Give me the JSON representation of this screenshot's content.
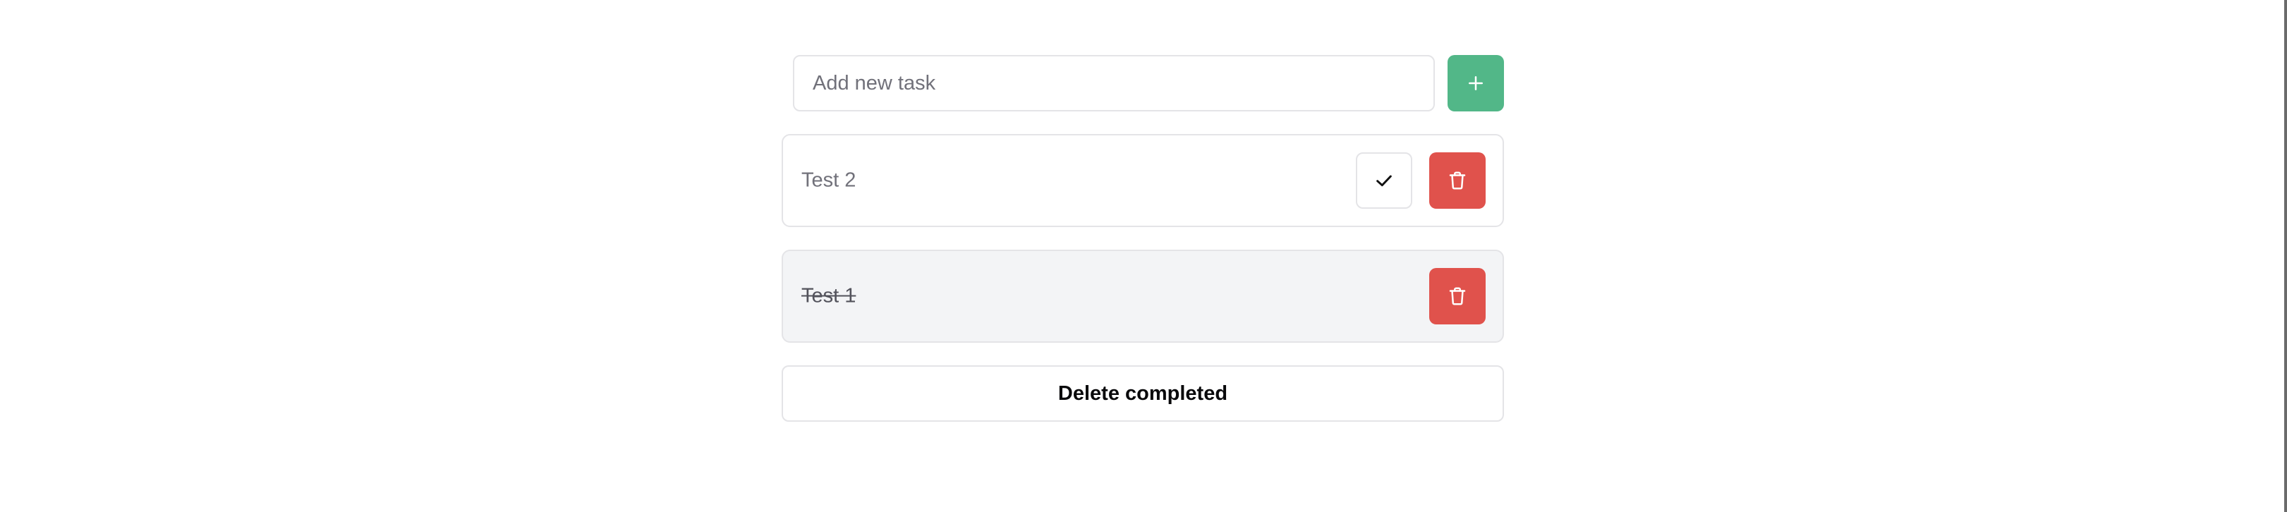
{
  "new_task": {
    "placeholder": "Add new task",
    "value": "",
    "add_icon": "plus-icon"
  },
  "tasks": [
    {
      "label": "Test 2",
      "completed": false,
      "complete_icon": "check-icon",
      "delete_icon": "trash-icon"
    },
    {
      "label": "Test 1",
      "completed": true,
      "delete_icon": "trash-icon"
    }
  ],
  "footer": {
    "delete_completed_label": "Delete completed"
  },
  "colors": {
    "add_button": "#52b788",
    "delete_button": "#e0524c",
    "completed_background": "#f3f4f6",
    "border": "#e4e4e7"
  }
}
